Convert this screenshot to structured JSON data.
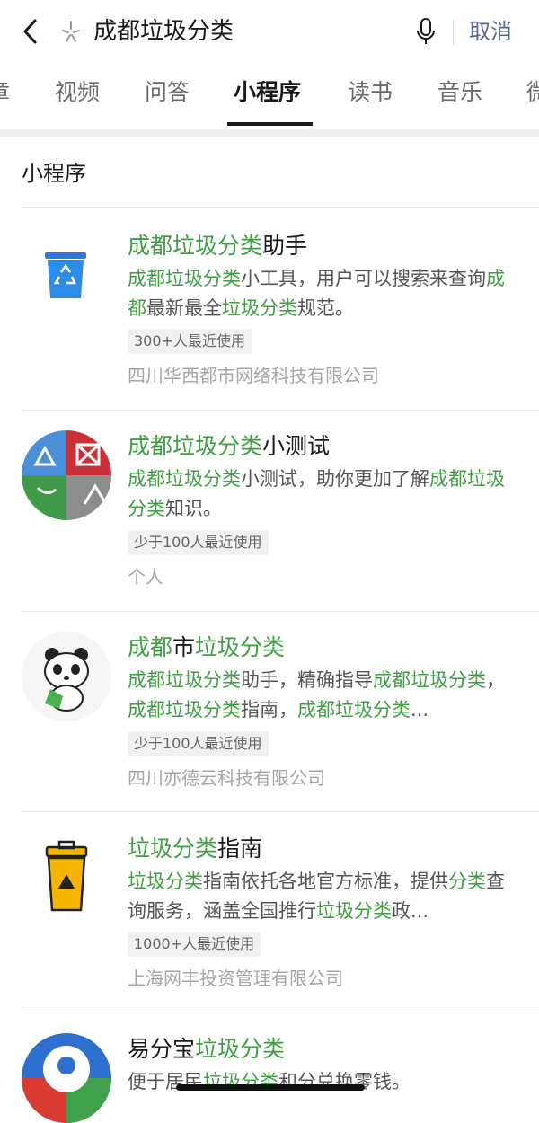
{
  "search": {
    "query": "成都垃圾分类",
    "cancel_label": "取消"
  },
  "tabs": [
    {
      "label": "章"
    },
    {
      "label": "视频"
    },
    {
      "label": "问答"
    },
    {
      "label": "小程序"
    },
    {
      "label": "读书"
    },
    {
      "label": "音乐"
    },
    {
      "label": "微"
    }
  ],
  "active_tab": "小程序",
  "section_title": "小程序",
  "results": [
    {
      "title": [
        {
          "t": "成都垃圾分类",
          "h": true
        },
        {
          "t": "助手",
          "h": false
        }
      ],
      "desc": [
        {
          "t": "成都垃圾分类",
          "h": true
        },
        {
          "t": "小工具，用户可以搜索来查询",
          "h": false
        },
        {
          "t": "成都",
          "h": true
        },
        {
          "t": "最新最全",
          "h": false
        },
        {
          "t": "垃圾分类",
          "h": true
        },
        {
          "t": "规范。",
          "h": false
        }
      ],
      "badge": "300+人最近使用",
      "owner": "四川华西都市网络科技有限公司",
      "icon": "blue-recycle-bin-icon"
    },
    {
      "title": [
        {
          "t": "成都垃圾分类",
          "h": true
        },
        {
          "t": "小测试",
          "h": false
        }
      ],
      "desc": [
        {
          "t": "成都垃圾分类",
          "h": true
        },
        {
          "t": "小测试，助你更加了解",
          "h": false
        },
        {
          "t": "成都垃圾分类",
          "h": true
        },
        {
          "t": "知识。",
          "h": false
        }
      ],
      "badge": "少于100人最近使用",
      "owner": "个人",
      "icon": "four-color-recycle-icon"
    },
    {
      "title": [
        {
          "t": "成都",
          "h": true
        },
        {
          "t": "市",
          "h": false
        },
        {
          "t": "垃圾分类",
          "h": true
        }
      ],
      "desc": [
        {
          "t": "成都垃圾分类",
          "h": true
        },
        {
          "t": "助手，精确指导",
          "h": false
        },
        {
          "t": "成都垃圾分类",
          "h": true
        },
        {
          "t": "， ",
          "h": false
        },
        {
          "t": "成都垃圾分类",
          "h": true
        },
        {
          "t": "指南，",
          "h": false
        },
        {
          "t": "成都垃圾分类",
          "h": true
        },
        {
          "t": "...",
          "h": false
        }
      ],
      "badge": "少于100人最近使用",
      "owner": "四川亦德云科技有限公司",
      "icon": "panda-mascot-icon"
    },
    {
      "title": [
        {
          "t": "垃圾分类",
          "h": true
        },
        {
          "t": "指南",
          "h": false
        }
      ],
      "desc": [
        {
          "t": "垃圾分类",
          "h": true
        },
        {
          "t": "指南依托各地官方标准，提供",
          "h": false
        },
        {
          "t": "分类",
          "h": true
        },
        {
          "t": "查询服务，涵盖全国推行",
          "h": false
        },
        {
          "t": "垃圾分类",
          "h": true
        },
        {
          "t": "政...",
          "h": false
        }
      ],
      "badge": "1000+人最近使用",
      "owner": "上海网丰投资管理有限公司",
      "icon": "yellow-hazard-bin-icon"
    },
    {
      "title": [
        {
          "t": "易分宝",
          "h": false
        },
        {
          "t": "垃圾分类",
          "h": true
        }
      ],
      "desc": [
        {
          "t": "便于居民",
          "h": false
        },
        {
          "t": "垃圾分类",
          "h": true
        },
        {
          "t": "和分兑换零钱。",
          "h": false
        }
      ],
      "icon": "tricolor-circle-logo-icon"
    }
  ],
  "colors": {
    "highlight": "#3f9f42",
    "cancel": "#576b95",
    "muted": "#a6a6a6"
  }
}
